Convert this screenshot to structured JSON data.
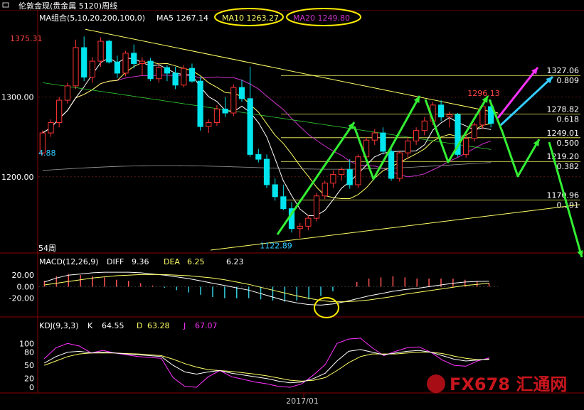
{
  "window": {
    "title": "伦敦金现(贵金属 5120)周线"
  },
  "indicators": {
    "ma_label": "MA组合(5,10,20,200,100,0)",
    "ma5": "MA5 1267.14",
    "ma10": "MA10 1263.27",
    "ma20": "MA20 1249.80",
    "macd_label": "MACD(12,26,9)",
    "diff_label": "DIFF",
    "diff_value": "9.36",
    "dea_label": "DEA",
    "dea_value": "6.25",
    "macd_value": "6.23",
    "kdj_label": "KDJ(9,3,3)",
    "k_label": "K",
    "k_value": "64.55",
    "d_label": "D",
    "d_value": "63.28",
    "j_label": "J",
    "j_value": "67.07"
  },
  "annotations": {
    "high_label": "1375.31",
    "low_label": "1122.89",
    "peak_label": "1296.13",
    "left_value": "4.88",
    "period_label": "54周",
    "date_label": "2017/01",
    "watermark": "FX678 汇通网"
  },
  "colors": {
    "up": "#ff3333",
    "down": "#00e5ee",
    "ma5": "#ffffff",
    "ma10": "#ffff66",
    "ma20": "#cc33cc",
    "ma_long1": "#33cc33",
    "ma_long2": "#999999",
    "fib": "#ffff66",
    "trend": "#ffff66",
    "arrow_green": "#33ee33",
    "arrow_cyan": "#33ccff",
    "arrow_magenta": "#ff33ff",
    "circle": "#ffee00"
  },
  "chart_data": [
    {
      "type": "candlestick",
      "title": "伦敦金现(贵金属 5120)周线",
      "ylim": [
        1108,
        1395
      ],
      "yticks": [
        1300.0,
        1200.0
      ],
      "ytick_labels": [
        "1300.00",
        "1200.00"
      ],
      "x_labels": [
        "2017/01"
      ],
      "candles": [
        {
          "o": 1230,
          "h": 1258,
          "l": 1227,
          "c": 1255
        },
        {
          "o": 1255,
          "h": 1272,
          "l": 1250,
          "c": 1268
        },
        {
          "o": 1268,
          "h": 1300,
          "l": 1262,
          "c": 1296
        },
        {
          "o": 1296,
          "h": 1318,
          "l": 1292,
          "c": 1314
        },
        {
          "o": 1314,
          "h": 1372,
          "l": 1310,
          "c": 1362
        },
        {
          "o": 1362,
          "h": 1376,
          "l": 1320,
          "c": 1325
        },
        {
          "o": 1325,
          "h": 1350,
          "l": 1318,
          "c": 1345
        },
        {
          "o": 1345,
          "h": 1375,
          "l": 1338,
          "c": 1370
        },
        {
          "o": 1370,
          "h": 1372,
          "l": 1342,
          "c": 1344
        },
        {
          "o": 1344,
          "h": 1352,
          "l": 1324,
          "c": 1330
        },
        {
          "o": 1330,
          "h": 1358,
          "l": 1326,
          "c": 1355
        },
        {
          "o": 1355,
          "h": 1366,
          "l": 1336,
          "c": 1342
        },
        {
          "o": 1342,
          "h": 1350,
          "l": 1327,
          "c": 1345
        },
        {
          "o": 1345,
          "h": 1349,
          "l": 1320,
          "c": 1323
        },
        {
          "o": 1323,
          "h": 1342,
          "l": 1318,
          "c": 1337
        },
        {
          "o": 1337,
          "h": 1340,
          "l": 1320,
          "c": 1330
        },
        {
          "o": 1330,
          "h": 1338,
          "l": 1310,
          "c": 1315
        },
        {
          "o": 1315,
          "h": 1340,
          "l": 1312,
          "c": 1336
        },
        {
          "o": 1336,
          "h": 1342,
          "l": 1318,
          "c": 1320
        },
        {
          "o": 1320,
          "h": 1325,
          "l": 1258,
          "c": 1263
        },
        {
          "o": 1263,
          "h": 1272,
          "l": 1255,
          "c": 1268
        },
        {
          "o": 1268,
          "h": 1290,
          "l": 1264,
          "c": 1285
        },
        {
          "o": 1285,
          "h": 1300,
          "l": 1275,
          "c": 1280
        },
        {
          "o": 1280,
          "h": 1316,
          "l": 1276,
          "c": 1312
        },
        {
          "o": 1312,
          "h": 1322,
          "l": 1294,
          "c": 1298
        },
        {
          "o": 1298,
          "h": 1338,
          "l": 1225,
          "c": 1228
        },
        {
          "o": 1228,
          "h": 1235,
          "l": 1218,
          "c": 1222
        },
        {
          "o": 1222,
          "h": 1228,
          "l": 1186,
          "c": 1190
        },
        {
          "o": 1190,
          "h": 1198,
          "l": 1170,
          "c": 1175
        },
        {
          "o": 1175,
          "h": 1190,
          "l": 1158,
          "c": 1160
        },
        {
          "o": 1160,
          "h": 1168,
          "l": 1130,
          "c": 1135
        },
        {
          "o": 1135,
          "h": 1142,
          "l": 1123,
          "c": 1138
        },
        {
          "o": 1138,
          "h": 1152,
          "l": 1133,
          "c": 1148
        },
        {
          "o": 1148,
          "h": 1180,
          "l": 1144,
          "c": 1176
        },
        {
          "o": 1176,
          "h": 1195,
          "l": 1172,
          "c": 1192
        },
        {
          "o": 1192,
          "h": 1208,
          "l": 1186,
          "c": 1203
        },
        {
          "o": 1203,
          "h": 1212,
          "l": 1195,
          "c": 1209
        },
        {
          "o": 1209,
          "h": 1222,
          "l": 1185,
          "c": 1190
        },
        {
          "o": 1190,
          "h": 1228,
          "l": 1186,
          "c": 1225
        },
        {
          "o": 1225,
          "h": 1250,
          "l": 1220,
          "c": 1246
        },
        {
          "o": 1246,
          "h": 1260,
          "l": 1240,
          "c": 1255
        },
        {
          "o": 1255,
          "h": 1262,
          "l": 1228,
          "c": 1232
        },
        {
          "o": 1232,
          "h": 1236,
          "l": 1195,
          "c": 1198
        },
        {
          "o": 1198,
          "h": 1232,
          "l": 1194,
          "c": 1230
        },
        {
          "o": 1230,
          "h": 1250,
          "l": 1222,
          "c": 1245
        },
        {
          "o": 1245,
          "h": 1262,
          "l": 1240,
          "c": 1258
        },
        {
          "o": 1258,
          "h": 1275,
          "l": 1252,
          "c": 1270
        },
        {
          "o": 1270,
          "h": 1294,
          "l": 1265,
          "c": 1290
        },
        {
          "o": 1290,
          "h": 1296,
          "l": 1270,
          "c": 1275
        },
        {
          "o": 1275,
          "h": 1282,
          "l": 1262,
          "c": 1278
        },
        {
          "o": 1278,
          "h": 1280,
          "l": 1225,
          "c": 1228
        },
        {
          "o": 1228,
          "h": 1252,
          "l": 1224,
          "c": 1248
        },
        {
          "o": 1248,
          "h": 1268,
          "l": 1244,
          "c": 1265
        },
        {
          "o": 1265,
          "h": 1292,
          "l": 1260,
          "c": 1288
        },
        {
          "o": 1288,
          "h": 1296,
          "l": 1262,
          "c": 1267
        }
      ],
      "ma_lines": [
        {
          "name": "MA5",
          "last": 1267.14
        },
        {
          "name": "MA10",
          "last": 1263.27
        },
        {
          "name": "MA20",
          "last": 1249.8
        }
      ],
      "fibonacci": [
        {
          "price": "1327.06",
          "ratio": "0.809"
        },
        {
          "price": "1278.82",
          "ratio": "0.618"
        },
        {
          "price": "1249.01",
          "ratio": "0.500"
        },
        {
          "price": "1219.20",
          "ratio": "0.382"
        },
        {
          "price": "1170.96",
          "ratio": "0.191"
        }
      ],
      "price_labels": {
        "high": 1375.31,
        "low": 1122.89,
        "peak": 1296.13
      }
    },
    {
      "type": "bar",
      "title": "MACD(12,26,9)",
      "ylim": [
        -45,
        35
      ],
      "yticks": [
        20,
        0,
        -20
      ],
      "ytick_labels": [
        "20.00",
        "0.00",
        "-20.00"
      ],
      "series": [
        {
          "name": "DIFF",
          "values": [
            8,
            15,
            20,
            22,
            24,
            25,
            25,
            25,
            24,
            22,
            20,
            17,
            14,
            10,
            6,
            2,
            -2,
            -6,
            -12,
            -18,
            -24,
            -28,
            -31,
            -32,
            -30,
            -26,
            -21,
            -16,
            -12,
            -8,
            -5,
            -3,
            0,
            3,
            6,
            8,
            9,
            9.36
          ]
        },
        {
          "name": "DEA",
          "values": [
            3,
            6,
            9,
            12,
            15,
            17,
            19,
            20,
            21,
            21,
            21,
            20,
            19,
            17,
            15,
            12,
            8,
            4,
            -1,
            -6,
            -11,
            -16,
            -20,
            -24,
            -26,
            -26,
            -25,
            -23,
            -20,
            -17,
            -13,
            -10,
            -7,
            -4,
            -1,
            2,
            4,
            6.25
          ]
        }
      ]
    },
    {
      "type": "line",
      "title": "KDJ(9,3,3)",
      "ylim": [
        0,
        115
      ],
      "yticks": [
        100,
        80,
        50,
        20,
        0
      ],
      "ytick_labels": [
        "100",
        "80",
        "50",
        "20",
        "0"
      ],
      "series": [
        {
          "name": "K",
          "values": [
            55,
            70,
            80,
            82,
            78,
            80,
            78,
            76,
            74,
            72,
            70,
            50,
            35,
            30,
            35,
            38,
            32,
            28,
            24,
            20,
            14,
            10,
            12,
            20,
            32,
            60,
            82,
            86,
            80,
            74,
            78,
            82,
            84,
            80,
            72,
            64,
            60,
            62,
            64.55
          ]
        },
        {
          "name": "D",
          "values": [
            50,
            60,
            70,
            76,
            78,
            78,
            78,
            77,
            76,
            74,
            72,
            64,
            54,
            46,
            40,
            38,
            36,
            33,
            30,
            26,
            21,
            16,
            14,
            16,
            22,
            38,
            56,
            70,
            76,
            76,
            76,
            78,
            80,
            80,
            77,
            71,
            66,
            63,
            63.28
          ]
        },
        {
          "name": "J",
          "values": [
            65,
            90,
            100,
            94,
            78,
            84,
            78,
            74,
            70,
            68,
            66,
            22,
            2,
            0,
            24,
            38,
            24,
            18,
            12,
            8,
            2,
            0,
            8,
            28,
            52,
            100,
            110,
            112,
            90,
            72,
            82,
            90,
            92,
            80,
            62,
            50,
            48,
            60,
            67.07
          ]
        }
      ]
    }
  ]
}
